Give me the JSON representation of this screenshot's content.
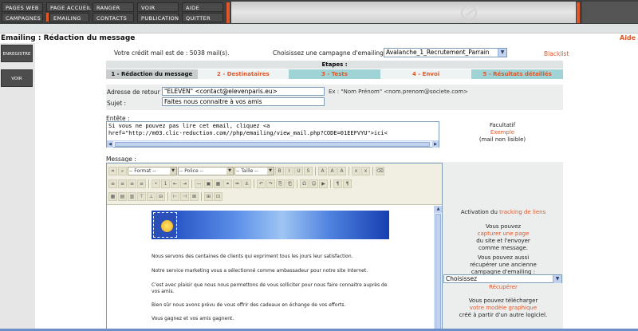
{
  "menu": {
    "row1": [
      "PAGES WEB",
      "PAGE ACCUEIL",
      "RANGER",
      "VOIR",
      "AIDE"
    ],
    "row2": [
      "CAMPAGNES",
      "EMAILING",
      "CONTACTS",
      "PUBLICATION",
      "QUITTER"
    ]
  },
  "page": {
    "title": "Emailing : Rédaction du message",
    "help": "Aide"
  },
  "left_buttons": {
    "save": "ENREGISTRE",
    "view": "VOIR"
  },
  "credit_text": "Votre crédit mail est de : 5038 mail(s).",
  "campaign": {
    "label": "Choisissez une campagne d'emailing :",
    "selected": "Avalanche_1_Recrutement_Parrain",
    "blacklist": "Blacklist"
  },
  "steps": {
    "header": "Etapes :",
    "items": [
      "1 - Rédaction du message",
      "2 - Destinataires",
      "3 - Tests",
      "4 - Envoi",
      "5 - Résultats détaillés"
    ]
  },
  "form": {
    "return_label": "Adresse de retour :",
    "return_value": "\"ELEVEN\" <contact@elevenparis.eu>",
    "return_hint": "Ex : \"Nom Prénom\" <nom.prenom@societe.com>",
    "subject_label": "Sujet :",
    "subject_value": "Faites nous connaitre à vos amis"
  },
  "header_section": {
    "label": "Entête :",
    "line1": "Si vous ne pouvez pas lire cet email, cliquez <a",
    "line2": "href=\"http://m03.clic-reduction.com//php/emailing/view_mail.php?CODE=01EEFVYU\">ici<",
    "optional": "Facultatif",
    "example": "Exemple",
    "example_note": "(mail non lisible)"
  },
  "message_section": {
    "label": "Message :",
    "toolbar": {
      "format": "-- Format --",
      "font": "-- Police --",
      "size": "-- Taille --"
    },
    "paragraphs": [
      "Nous servons des centaines de clients qui expriment tous les jours leur satisfaction.",
      "Notre service marketing vous a sélectionné comme ambassadeur pour notre site Internet.",
      "C'est avec plaisir que nous nous permettons de vous solliciter pour nous faire connaitre auprès de vos amis.",
      "Bien sûr nous avons prévu de vous offrir des cadeaux en échange de vos efforts.",
      "Vous gagnez et vos amis gagnent."
    ]
  },
  "side": {
    "tracking_pre": "Activation du",
    "tracking_link": "tracking de liens",
    "capture_pre": "Vous pouvez",
    "capture_link": "capturer une page",
    "capture_post1": "du site et l'envoyer",
    "capture_post2": "comme message.",
    "recover1": "Vous pouvez aussi",
    "recover2": "récupérer une ancienne",
    "recover3": "campagne d'emailing :",
    "choose": "Choisissez",
    "recover_link": "Récupérer",
    "download1": "Vous pouvez télécharger",
    "download_link": "votre modèle graphique",
    "download2": "créé à partir d'un autre logiciel."
  },
  "colors": {
    "accent": "#e0582a",
    "menu_bg": "#3f3f3f",
    "step_teal": "#9fd3d5"
  }
}
